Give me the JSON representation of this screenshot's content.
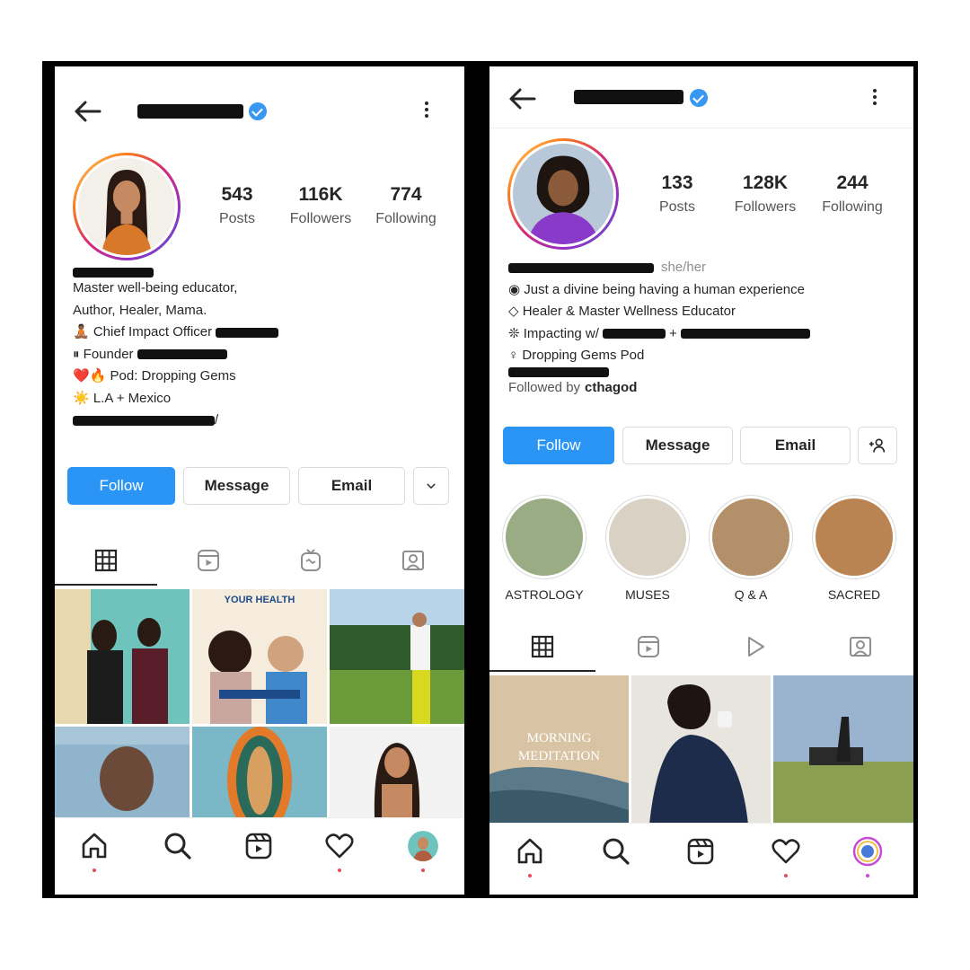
{
  "left_profile": {
    "stats": [
      {
        "value": "543",
        "label": "Posts"
      },
      {
        "value": "116K",
        "label": "Followers"
      },
      {
        "value": "774",
        "label": "Following"
      }
    ],
    "bio": {
      "line1": "Master well-being educator,",
      "line2": "Author, Healer, Mama.",
      "line3": "🧘🏾 Chief Impact Officer",
      "line4": "⏸ Founder",
      "line5": "❤️🔥 Pod: Dropping Gems",
      "line6": "☀️ L.A + Mexico",
      "link_suffix": "/"
    },
    "buttons": {
      "follow": "Follow",
      "message": "Message",
      "email": "Email"
    },
    "grid_overlay_text": "YOUR HEALTH"
  },
  "right_profile": {
    "stats": [
      {
        "value": "133",
        "label": "Posts"
      },
      {
        "value": "128K",
        "label": "Followers"
      },
      {
        "value": "244",
        "label": "Following"
      }
    ],
    "pronouns": "she/her",
    "bio": {
      "line1": "◉ Just a divine being having a human experience",
      "line2": "◇ Healer & Master Wellness Educator",
      "line3_prefix": "❊ Impacting w/",
      "line3_plus": "+",
      "line4": "♀ Dropping Gems Pod"
    },
    "followed_by_prefix": "Followed by",
    "followed_by_user": "cthagod",
    "buttons": {
      "follow": "Follow",
      "message": "Message",
      "email": "Email"
    },
    "highlights": [
      {
        "label": "ASTROLOGY",
        "color": "#9aac84"
      },
      {
        "label": "MUSES",
        "color": "#d9d2c4"
      },
      {
        "label": "Q & A",
        "color": "#b3906a"
      },
      {
        "label": "SACRED",
        "color": "#b98452"
      }
    ],
    "grid_overlay_line1": "MORNING",
    "grid_overlay_line2": "MEDITATION"
  },
  "colors": {
    "accent": "#2a95f4",
    "verified": "#3897f0",
    "notification": "#ed4956"
  },
  "icons": [
    "back-arrow-icon",
    "verified-icon",
    "kebab-menu-icon",
    "grid-icon",
    "reels-icon",
    "igtv-icon",
    "tagged-icon",
    "home-icon",
    "search-icon",
    "heart-icon",
    "add-person-icon",
    "chevron-down-icon"
  ]
}
